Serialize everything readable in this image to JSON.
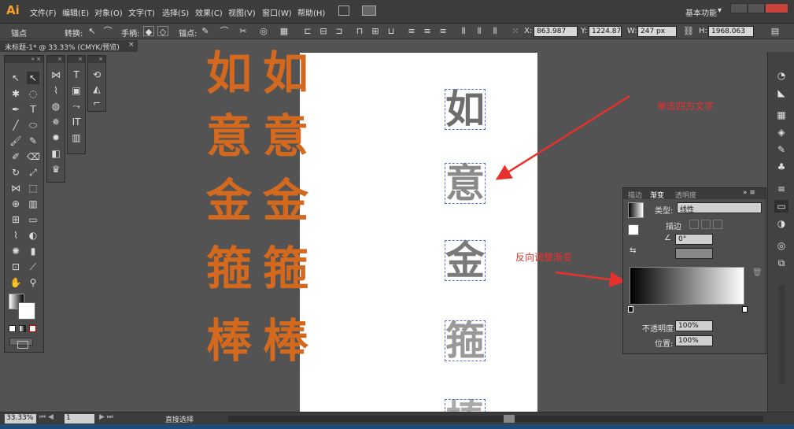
{
  "app": {
    "logo": "Ai",
    "menus": [
      "文件(F)",
      "编辑(E)",
      "对象(O)",
      "文字(T)",
      "选择(S)",
      "效果(C)",
      "视图(V)",
      "窗口(W)",
      "帮助(H)"
    ],
    "workspace": "基本功能",
    "workspace_dropdown": "▾"
  },
  "control_bar": {
    "anchor_label": "锚点",
    "convert_label": "转换:",
    "handle_label": "手柄:",
    "anchor_point_label": "锚点:",
    "x_value": "863.987",
    "y_value": "1224.87",
    "w_value": "247 px",
    "h_value": "1968.063"
  },
  "document": {
    "tab_title": "未标题-1* @ 33.33% (CMYK/预览)",
    "close": "×"
  },
  "artwork": {
    "chars": [
      "如",
      "意",
      "金",
      "箍",
      "棒"
    ]
  },
  "annotations": {
    "top_note": "单击四方文字",
    "mid_note": "反向调整渐变"
  },
  "gradient_panel": {
    "tabs": [
      "描边",
      "渐变",
      "透明度"
    ],
    "type_label": "类型:",
    "type_value": "线性",
    "stroke_label": "描边",
    "angle_value": "0°",
    "opacity_label": "不透明度:",
    "opacity_value": "100%",
    "location_label": "位置:",
    "location_value": "100%"
  },
  "status_bar": {
    "zoom": "33.33%",
    "page": "1",
    "tool_name": "直接选择"
  }
}
